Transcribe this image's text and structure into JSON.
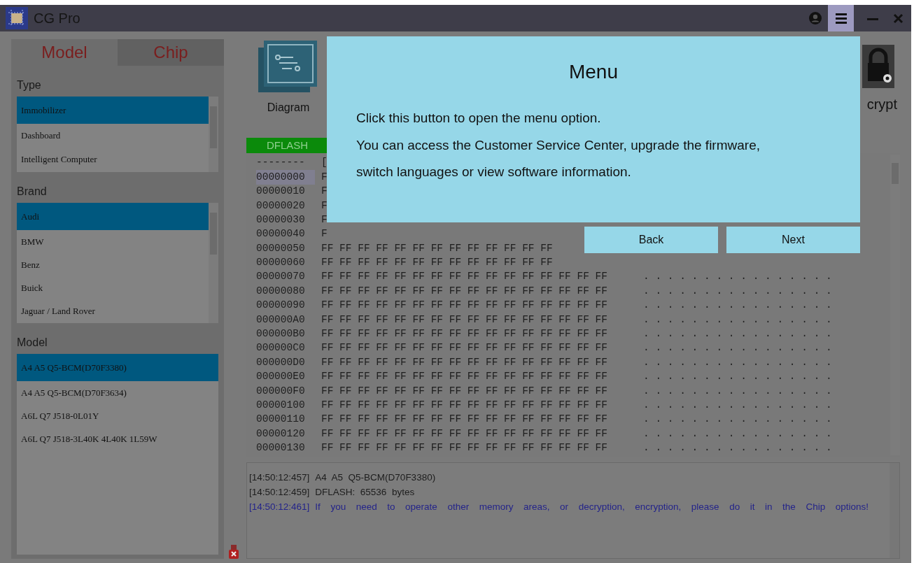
{
  "window": {
    "title": "CG Pro"
  },
  "title_bar_buttons": [
    {
      "kind": "user",
      "highlighted": false
    },
    {
      "kind": "menu",
      "highlighted": true
    },
    {
      "kind": "minimize",
      "highlighted": false
    },
    {
      "kind": "close",
      "highlighted": false
    }
  ],
  "left_panel": {
    "tabs": [
      {
        "label": "Model",
        "selected": true
      },
      {
        "label": "Chip",
        "selected": false
      }
    ],
    "sections": [
      {
        "label": "Type",
        "scrollable": true,
        "items": [
          {
            "label": "Immobilizer",
            "selected": true
          },
          {
            "label": "Dashboard",
            "selected": false
          },
          {
            "label": "Intelligent Computer",
            "selected": false
          }
        ]
      },
      {
        "label": "Brand",
        "scrollable": true,
        "items": [
          {
            "label": "Audi",
            "selected": true
          },
          {
            "label": "BMW",
            "selected": false
          },
          {
            "label": "Benz",
            "selected": false
          },
          {
            "label": "Buick",
            "selected": false
          },
          {
            "label": "Jaguar / Land Rover",
            "selected": false
          }
        ]
      },
      {
        "label": "Model",
        "scrollable": false,
        "items": [
          {
            "label": "A4 A5 Q5-BCM(D70F3380)",
            "selected": true
          },
          {
            "label": "A4 A5 Q5-BCM(D70F3634)",
            "selected": false
          },
          {
            "label": "A6L Q7 J518-0L01Y",
            "selected": false
          },
          {
            "label": "A6L Q7 J518-3L40K 4L40K 1L59W",
            "selected": false
          }
        ]
      }
    ]
  },
  "toolbar": {
    "buttons": [
      {
        "kind": "diagram",
        "label": "Diagram"
      },
      {
        "kind": "encrypt",
        "label": "crypt"
      }
    ],
    "memory_tab": "DFLASH"
  },
  "hex_view": {
    "header": {
      "address": "--------",
      "bytes": "["
    },
    "rows": [
      {
        "address": "00000000",
        "bytes": "F",
        "selected": true
      },
      {
        "address": "00000010",
        "bytes": "F",
        "selected": false
      },
      {
        "address": "00000020",
        "bytes": "F",
        "selected": false
      },
      {
        "address": "00000030",
        "bytes": "F",
        "selected": false
      },
      {
        "address": "00000040",
        "bytes": "F",
        "selected": false
      },
      {
        "address": "00000050",
        "bytes": "FF FF FF FF FF FF FF FF FF FF FF FF FF",
        "selected": false
      },
      {
        "address": "00000060",
        "bytes": "FF FF FF FF FF FF FF FF FF FF FF FF FF",
        "selected": false
      },
      {
        "address": "00000070",
        "bytes": "FF FF FF FF FF FF FF FF FF FF FF FF FF FF FF FF",
        "ascii": ". . . . . . . . . . . . . . . .",
        "selected": false
      },
      {
        "address": "00000080",
        "bytes": "FF FF FF FF FF FF FF FF FF FF FF FF FF FF FF FF",
        "ascii": ". . . . . . . . . . . . . . . .",
        "selected": false
      },
      {
        "address": "00000090",
        "bytes": "FF FF FF FF FF FF FF FF FF FF FF FF FF FF FF FF",
        "ascii": ". . . . . . . . . . . . . . . .",
        "selected": false
      },
      {
        "address": "000000A0",
        "bytes": "FF FF FF FF FF FF FF FF FF FF FF FF FF FF FF FF",
        "ascii": ". . . . . . . . . . . . . . . .",
        "selected": false
      },
      {
        "address": "000000B0",
        "bytes": "FF FF FF FF FF FF FF FF FF FF FF FF FF FF FF FF",
        "ascii": ". . . . . . . . . . . . . . . .",
        "selected": false
      },
      {
        "address": "000000C0",
        "bytes": "FF FF FF FF FF FF FF FF FF FF FF FF FF FF FF FF",
        "ascii": ". . . . . . . . . . . . . . . .",
        "selected": false
      },
      {
        "address": "000000D0",
        "bytes": "FF FF FF FF FF FF FF FF FF FF FF FF FF FF FF FF",
        "ascii": ". . . . . . . . . . . . . . . .",
        "selected": false
      },
      {
        "address": "000000E0",
        "bytes": "FF FF FF FF FF FF FF FF FF FF FF FF FF FF FF FF",
        "ascii": ". . . . . . . . . . . . . . . .",
        "selected": false
      },
      {
        "address": "000000F0",
        "bytes": "FF FF FF FF FF FF FF FF FF FF FF FF FF FF FF FF",
        "ascii": ". . . . . . . . . . . . . . . .",
        "selected": false
      },
      {
        "address": "00000100",
        "bytes": "FF FF FF FF FF FF FF FF FF FF FF FF FF FF FF FF",
        "ascii": ". . . . . . . . . . . . . . . .",
        "selected": false
      },
      {
        "address": "00000110",
        "bytes": "FF FF FF FF FF FF FF FF FF FF FF FF FF FF FF FF",
        "ascii": ". . . . . . . . . . . . . . . .",
        "selected": false
      },
      {
        "address": "00000120",
        "bytes": "FF FF FF FF FF FF FF FF FF FF FF FF FF FF FF FF",
        "ascii": ". . . . . . . . . . . . . . . .",
        "selected": false
      },
      {
        "address": "00000130",
        "bytes": "FF FF FF FF FF FF FF FF FF FF FF FF FF FF FF FF",
        "ascii": ". . . . . . . . . . . . . . . .",
        "selected": false
      }
    ]
  },
  "log": [
    {
      "kind": "info",
      "time": "[14:50:12:457]",
      "text": "A4  A5  Q5-BCM(D70F3380)"
    },
    {
      "kind": "info",
      "time": "[14:50:12:459]",
      "text": "DFLASH:  65536  bytes"
    },
    {
      "kind": "hint",
      "time": "[14:50:12:461]",
      "text": "If you need to operate other memory areas, or decryption, encryption, please do it in the Chip options!"
    }
  ],
  "tour": {
    "title": "Menu",
    "lines": [
      "Click this button to open the menu option.",
      "You can access the Customer Service Center, upgrade the firmware,",
      "switch languages or view software information."
    ],
    "buttons": [
      "Back",
      "Next"
    ]
  }
}
